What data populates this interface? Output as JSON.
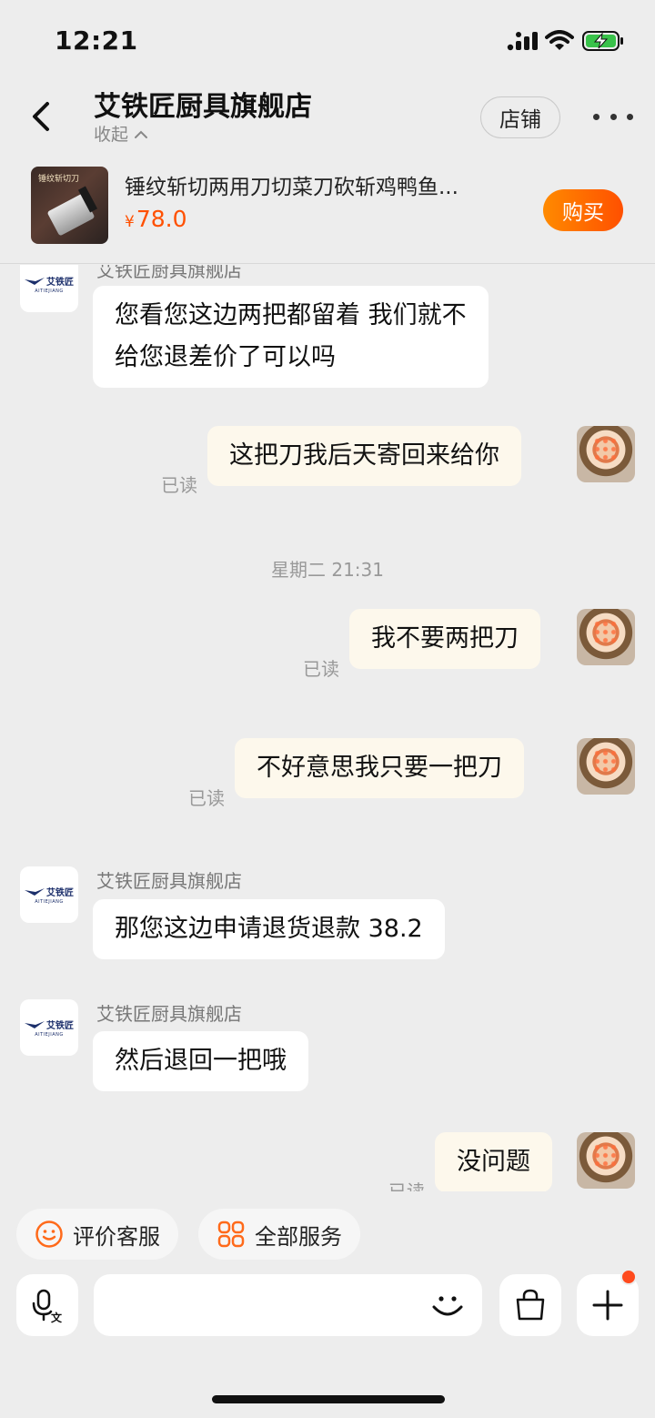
{
  "status_bar": {
    "time": "12:21"
  },
  "header": {
    "title": "艾铁匠厨具旗舰店",
    "collapse_label": "收起",
    "store_button": "店铺"
  },
  "product": {
    "thumb_text": "锤纹斩切刀",
    "title": "锤纹斩切两用刀切菜刀砍斩鸡鸭鱼...",
    "currency": "¥",
    "price": "78.0",
    "buy_button": "购买"
  },
  "shop_logo": {
    "cn": "艾铁匠",
    "en": "AITIEJIANG"
  },
  "messages": {
    "m1": {
      "sender": "艾铁匠厨具旗舰店",
      "line1": "您看您这边两把都留着  我们就不",
      "line2": "给您退差价了可以吗"
    },
    "m2": {
      "text": "这把刀我后天寄回来给你",
      "status": "已读"
    },
    "timestamp": "星期二 21:31",
    "m3": {
      "text": "我不要两把刀",
      "status": "已读"
    },
    "m4": {
      "text": "不好意思我只要一把刀",
      "status": "已读"
    },
    "m5": {
      "sender": "艾铁匠厨具旗舰店",
      "text": "那您这边申请退货退款 38.2"
    },
    "m6": {
      "sender": "艾铁匠厨具旗舰店",
      "text": "然后退回一把哦"
    },
    "m7": {
      "text": "没问题",
      "status": "已读"
    }
  },
  "services": {
    "rate": "评价客服",
    "all": "全部服务"
  },
  "voice_badge": "文",
  "colors": {
    "accent": "#ff5000",
    "outgoing_bubble": "#fdf8ec",
    "background": "#ededed"
  }
}
